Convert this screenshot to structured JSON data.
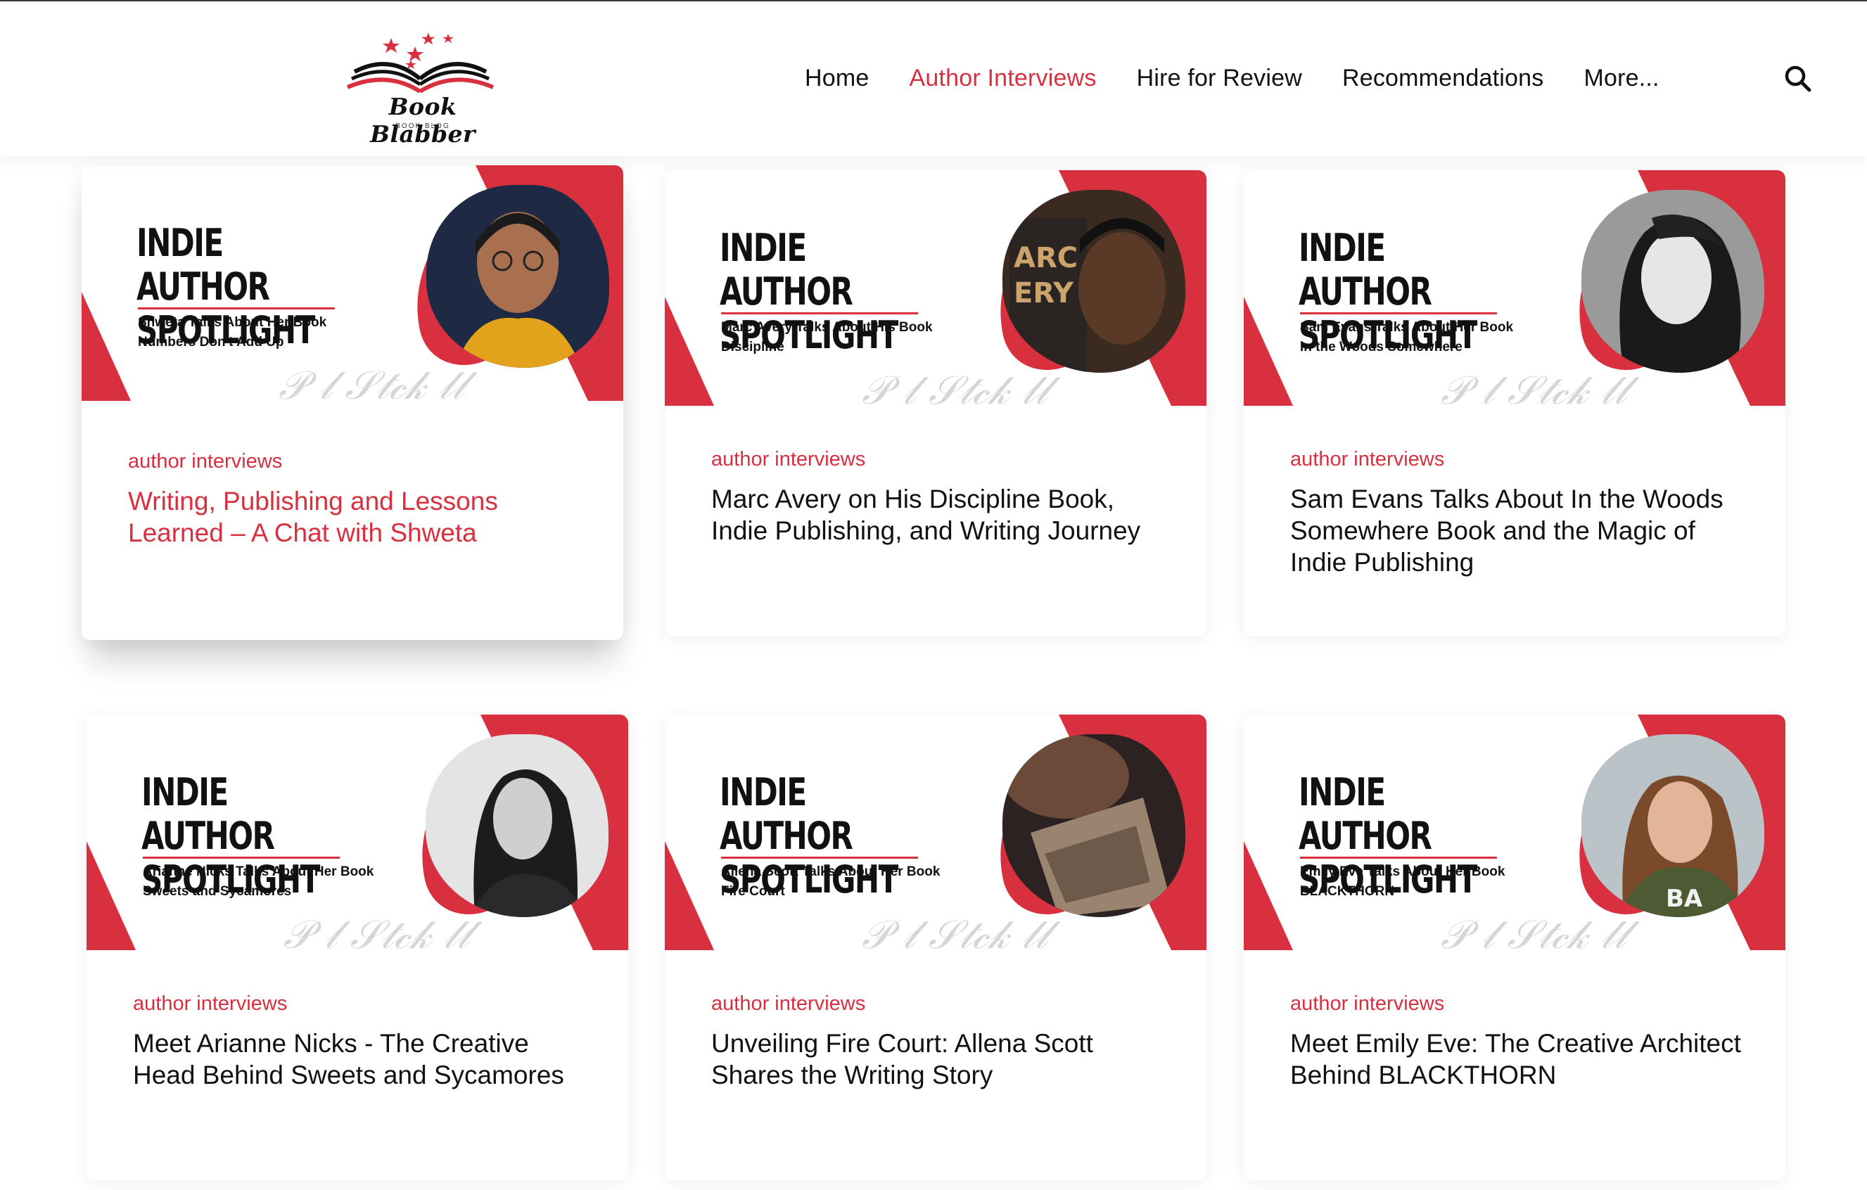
{
  "site": {
    "logo_text": "Book Blabber",
    "logo_sub": "BOOK BLOG"
  },
  "nav": {
    "items": [
      {
        "label": "Home",
        "active": false
      },
      {
        "label": "Author Interviews",
        "active": true
      },
      {
        "label": "Hire for Review",
        "active": false
      },
      {
        "label": "Recommendations",
        "active": false
      },
      {
        "label": "More..."
      }
    ],
    "search_icon": "search-icon"
  },
  "colors": {
    "accent": "#d8303f",
    "text": "#111111"
  },
  "cards": [
    {
      "thumb_title": "INDIE AUTHOR SPOTLIGHT",
      "thumb_line1": "Shweta Talks About Her Book",
      "thumb_line2": "Numbers Don't Add Up",
      "category": "author interviews",
      "title": "Writing, Publishing and Lessons Learned – A Chat with Shweta"
    },
    {
      "thumb_title": "INDIE AUTHOR SPOTLIGHT",
      "thumb_line1": "Marc Avery Talks About His Book",
      "thumb_line2": "Discipline",
      "category": "author interviews",
      "title": "Marc Avery on His Discipline Book, Indie Publishing, and Writing Journey"
    },
    {
      "thumb_title": "INDIE AUTHOR SPOTLIGHT",
      "thumb_line1": "Sam Evans Talks About Her Book",
      "thumb_line2": "In the Woods Somewhere",
      "category": "author interviews",
      "title": "Sam Evans Talks About In the Woods Somewhere Book and the Magic of Indie Publishing"
    },
    {
      "thumb_title": "INDIE AUTHOR SPOTLIGHT",
      "thumb_line1": "Arianne Nicks Talks About Her Book",
      "thumb_line2": "Sweets and Sycamores",
      "category": "author interviews",
      "title": "Meet Arianne Nicks - The Creative Head Behind Sweets and Sycamores"
    },
    {
      "thumb_title": "INDIE AUTHOR SPOTLIGHT",
      "thumb_line1": "Allena Scott Talks About Her Book",
      "thumb_line2": "Fire Court",
      "category": "author interviews",
      "title": "Unveiling Fire Court: Allena Scott Shares the Writing Story"
    },
    {
      "thumb_title": "INDIE AUTHOR SPOTLIGHT",
      "thumb_line1": "Emily Eve Talks About Her Book",
      "thumb_line2": "BLACKTHORN",
      "category": "author interviews",
      "title": "Meet Emily Eve: The Creative Architect Behind BLACKTHORN"
    }
  ]
}
